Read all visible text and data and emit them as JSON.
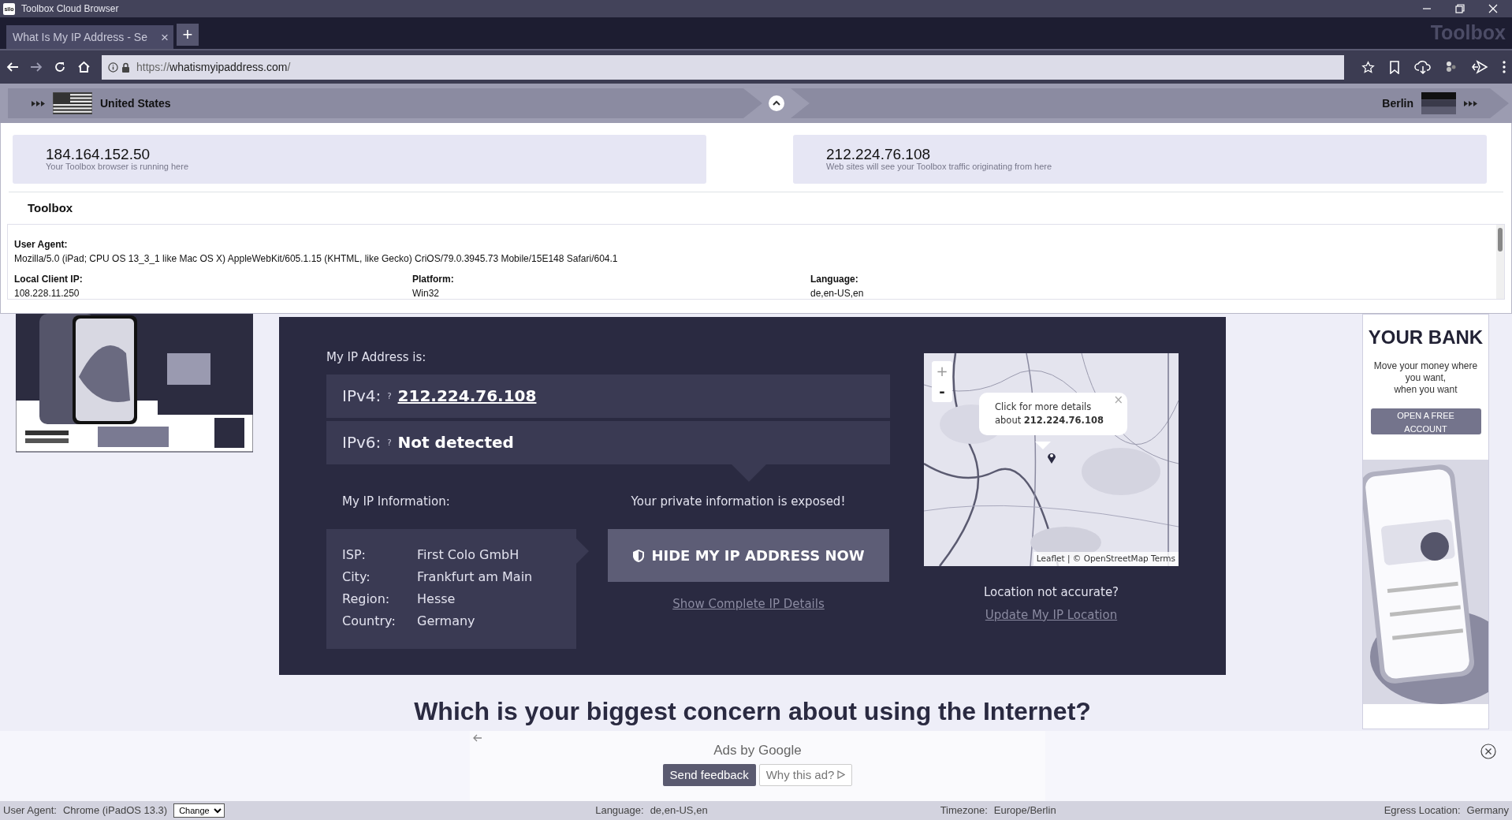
{
  "window": {
    "logo": "silo",
    "title": "Toolbox Cloud Browser"
  },
  "tabs": [
    {
      "label": "What Is My IP Address - Se",
      "close": "×",
      "selected": true
    }
  ],
  "new_tab": "+",
  "brand": "Toolbox",
  "address_bar": {
    "scheme": "https://",
    "host": "whatismyipaddress.com",
    "path": "/"
  },
  "route": {
    "origin": "United States",
    "destination": "Berlin"
  },
  "ip_cards": [
    {
      "ip": "184.164.152.50",
      "caption": "Your Toolbox browser is running here"
    },
    {
      "ip": "212.224.76.108",
      "caption": "Web sites will see your Toolbox traffic originating from here"
    }
  ],
  "toolbox": {
    "title": "Toolbox",
    "user_agent": {
      "label": "User Agent:",
      "value": "Mozilla/5.0 (iPad; CPU OS 13_3_1 like Mac OS X) AppleWebKit/605.1.15 (KHTML, like Gecko) CriOS/79.0.3945.73 Mobile/15E148 Safari/604.1"
    },
    "fields": [
      {
        "label": "Local Client IP:",
        "value": "108.228.11.250"
      },
      {
        "label": "Platform:",
        "value": "Win32"
      },
      {
        "label": "Language:",
        "value": "de,en-US,en"
      }
    ]
  },
  "ip_panel": {
    "heading": "My IP Address is:",
    "addresses": [
      {
        "label": "IPv4:",
        "help": "?",
        "value": "212.224.76.108",
        "link": true
      },
      {
        "label": "IPv6:",
        "help": "?",
        "value": "Not detected",
        "link": false
      }
    ],
    "info_heading": "My IP Information:",
    "exposed_note": "Your private information is exposed!",
    "info": [
      {
        "label": "ISP:",
        "value": "First Colo GmbH"
      },
      {
        "label": "City:",
        "value": "Frankfurt am Main"
      },
      {
        "label": "Region:",
        "value": "Hesse"
      },
      {
        "label": "Country:",
        "value": "Germany"
      }
    ],
    "hide_button": "HIDE MY IP ADDRESS NOW",
    "details_link": "Show Complete IP Details",
    "map": {
      "zoom_in": "+",
      "zoom_out": "-",
      "popup": "Click for more details about **212.224.76.108**",
      "popup_close": "×",
      "attribution": "Leaflet | © OpenStreetMap Terms"
    },
    "location_question": "Location not accurate?",
    "update_link": "Update My IP Location"
  },
  "concern_heading": "Which is your biggest concern about using the Internet?",
  "right_ad": {
    "heading": "YOUR BANK",
    "lines": [
      "Move your money where",
      "you want,",
      "when you want"
    ],
    "button": "OPEN A FREE ACCOUNT"
  },
  "google_ads": {
    "title": "Ads by Google",
    "feedback": "Send feedback",
    "why": "Why this ad?"
  },
  "status_bar": {
    "user_agent": {
      "label": "User Agent:",
      "value": "Chrome (iPadOS 13.3)"
    },
    "change": "Change",
    "items": [
      {
        "label": "Language:",
        "value": "de,en-US,en"
      },
      {
        "label": "Timezone:",
        "value": "Europe/Berlin"
      },
      {
        "label": "Egress Location:",
        "value": "Germany"
      }
    ]
  }
}
